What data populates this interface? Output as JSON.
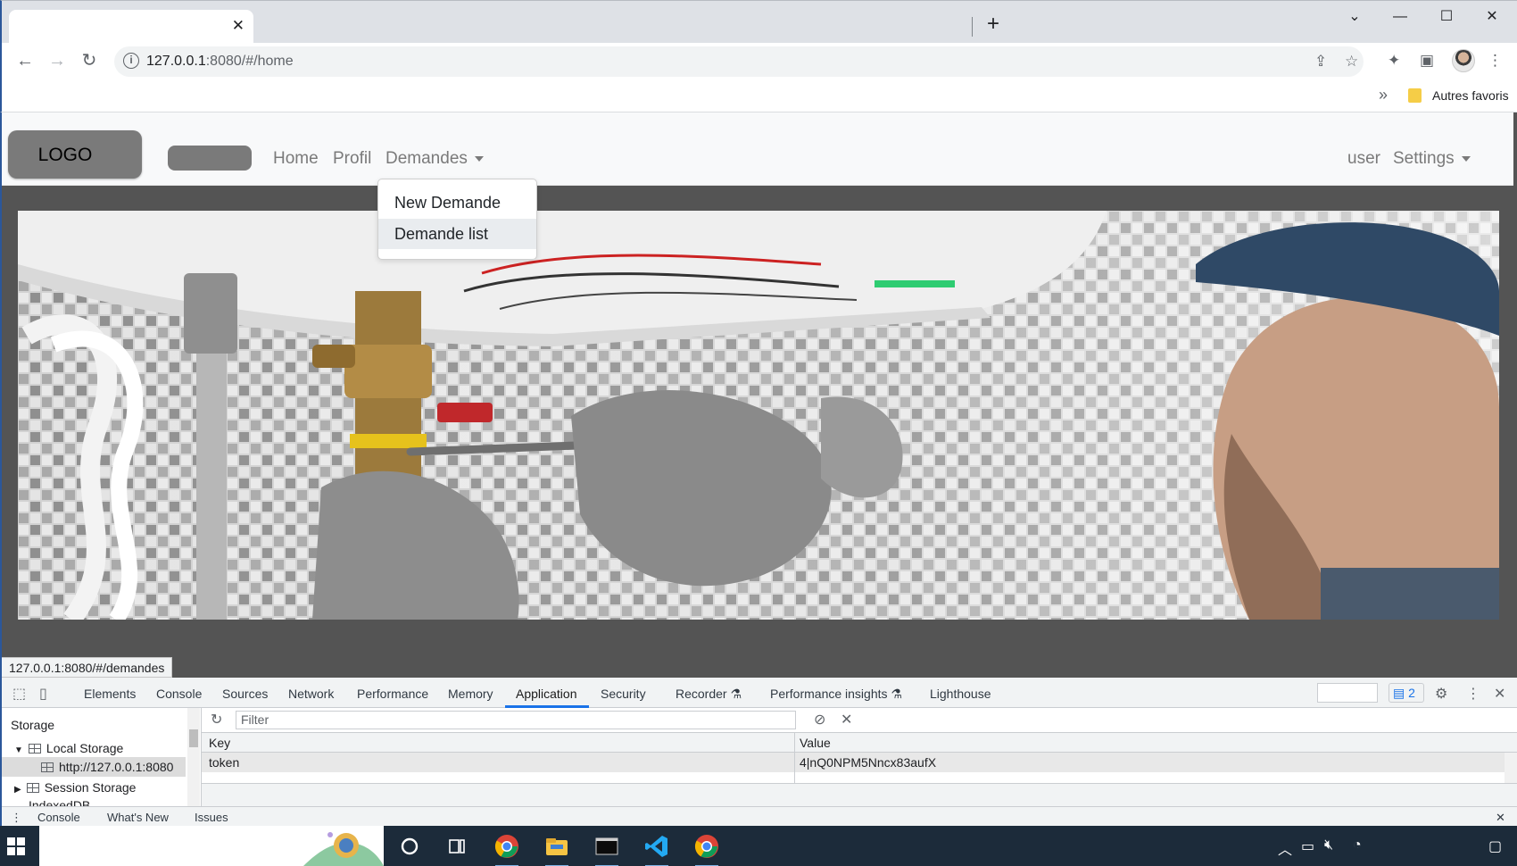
{
  "browser": {
    "tab_close": "✕",
    "new_tab": "+",
    "window_controls": {
      "tabs_menu": "⌄",
      "minimize": "—",
      "maximize": "☐",
      "close": "✕"
    },
    "url_host": "127.0.0.1",
    "url_rest": ":8080/#/home",
    "bookmarks": {
      "chevron": "»",
      "other_bookmarks": "Autres favoris"
    }
  },
  "page": {
    "logo": "LOGO",
    "nav": {
      "home": "Home",
      "profil": "Profil",
      "demandes": "Demandes",
      "user": "user",
      "settings": "Settings"
    },
    "dropdown": {
      "items": [
        "New Demande",
        "Demande list"
      ],
      "hovered_index": 1
    },
    "status_url": "127.0.0.1:8080/#/demandes"
  },
  "devtools": {
    "tabs": [
      "Elements",
      "Console",
      "Sources",
      "Network",
      "Performance",
      "Memory",
      "Application",
      "Security",
      "Recorder",
      "Performance insights",
      "Lighthouse"
    ],
    "active_tab": "Application",
    "issues_count": "2",
    "sidebar": {
      "storage_header": "Storage",
      "local_storage": "Local Storage",
      "origin": "http://127.0.0.1:8080",
      "session_storage": "Session Storage",
      "indexeddb": "IndexedDB"
    },
    "filter_placeholder": "Filter",
    "table": {
      "columns": [
        "Key",
        "Value"
      ],
      "rows": [
        {
          "key": "token",
          "value": "4|nQ0NPM5Nncx83aufX"
        }
      ]
    },
    "drawer": {
      "console": "Console",
      "whats_new": "What's New",
      "issues": "Issues"
    }
  },
  "colors": {
    "accent": "#1a73e8",
    "navbar_bg": "#f8f9fa",
    "nav_link": "#7a7a7a",
    "taskbar": "#1c2b3a"
  },
  "icons": [
    "back-arrow-icon",
    "forward-arrow-icon",
    "reload-icon",
    "info-icon",
    "share-icon",
    "star-icon",
    "extensions-icon",
    "side-panel-icon",
    "profile-avatar-icon",
    "menu-kebab-icon",
    "folder-icon",
    "inspect-icon",
    "device-icon",
    "gear-icon",
    "refresh-icon",
    "clear-icon",
    "windows-start-icon",
    "cortana-icon",
    "task-view-icon",
    "chrome-icon",
    "file-explorer-icon",
    "terminal-icon",
    "vscode-icon"
  ]
}
